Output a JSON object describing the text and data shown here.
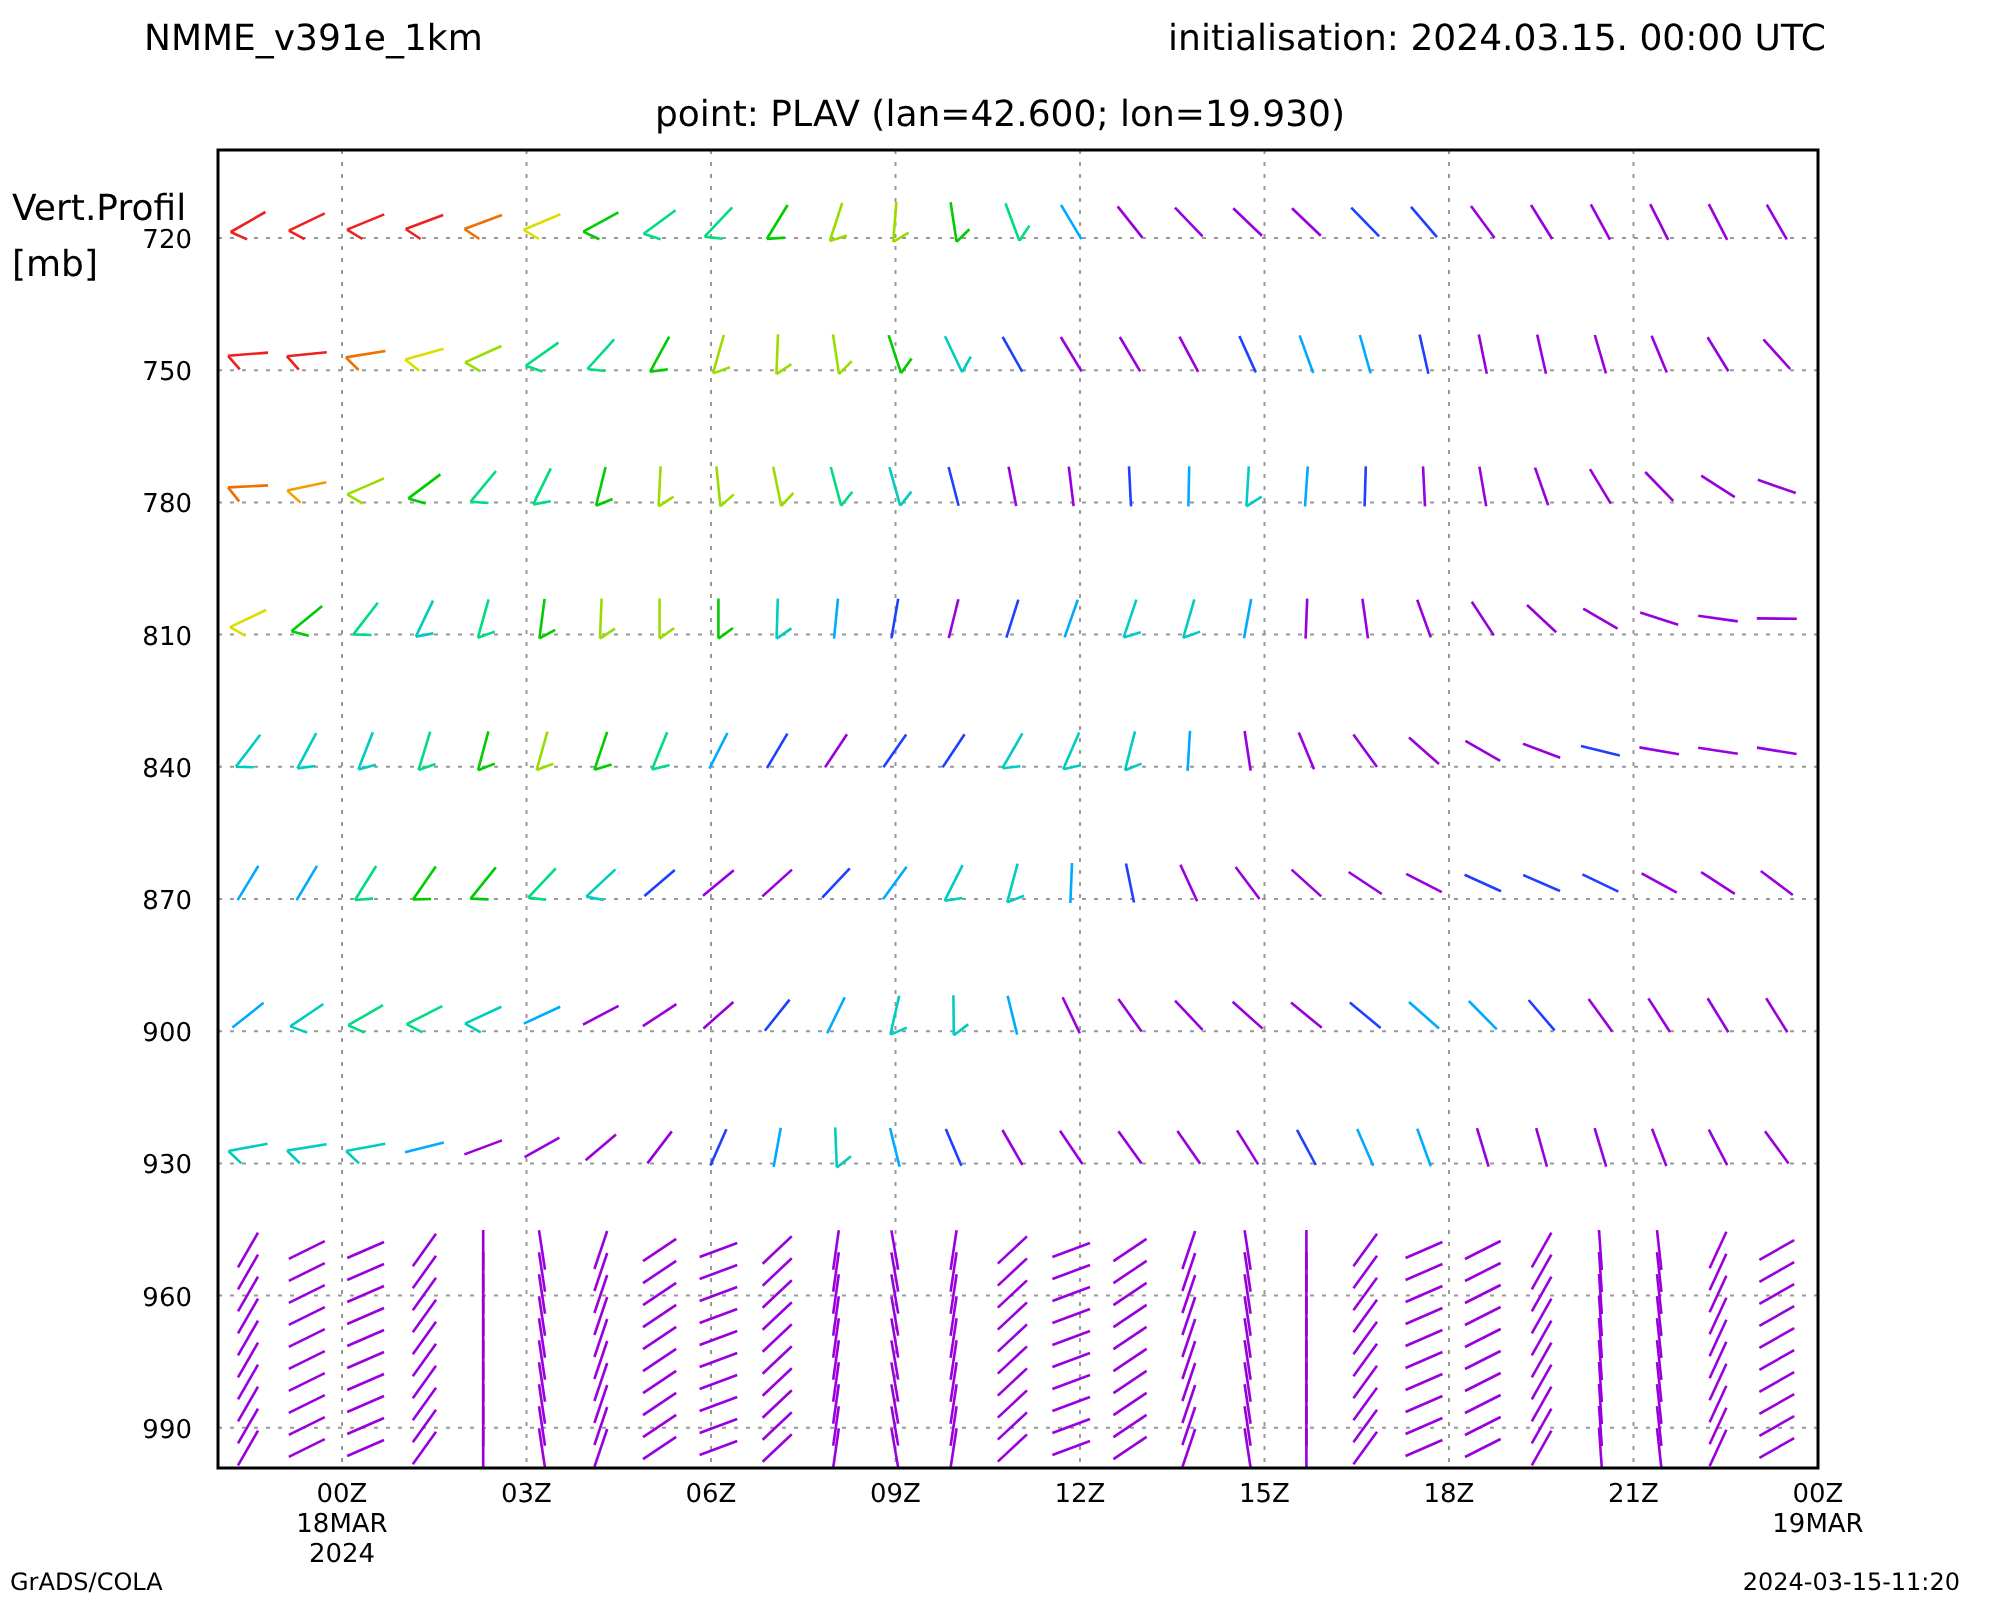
{
  "header": {
    "model": "NMME_v391e_1km",
    "initialisation": "initialisation: 2024.03.15. 00:00 UTC"
  },
  "plot_title": "point: PLAV (lan=42.600; lon=19.930)",
  "y_axis": {
    "label": [
      "Vert.Profil",
      "[mb]"
    ],
    "ticks": [
      "720",
      "750",
      "780",
      "810",
      "840",
      "870",
      "900",
      "930",
      "960",
      "990"
    ]
  },
  "x_axis": {
    "ticks": [
      {
        "lines": [
          "00Z",
          "18MAR",
          "2024"
        ]
      },
      {
        "lines": [
          "03Z"
        ]
      },
      {
        "lines": [
          "06Z"
        ]
      },
      {
        "lines": [
          "09Z"
        ]
      },
      {
        "lines": [
          "12Z"
        ]
      },
      {
        "lines": [
          "15Z"
        ]
      },
      {
        "lines": [
          "18Z"
        ]
      },
      {
        "lines": [
          "21Z"
        ]
      },
      {
        "lines": [
          "00Z",
          "19MAR"
        ]
      }
    ]
  },
  "footer": {
    "left": "GrADS/COLA",
    "right": "2024-03-15-11:20"
  }
}
